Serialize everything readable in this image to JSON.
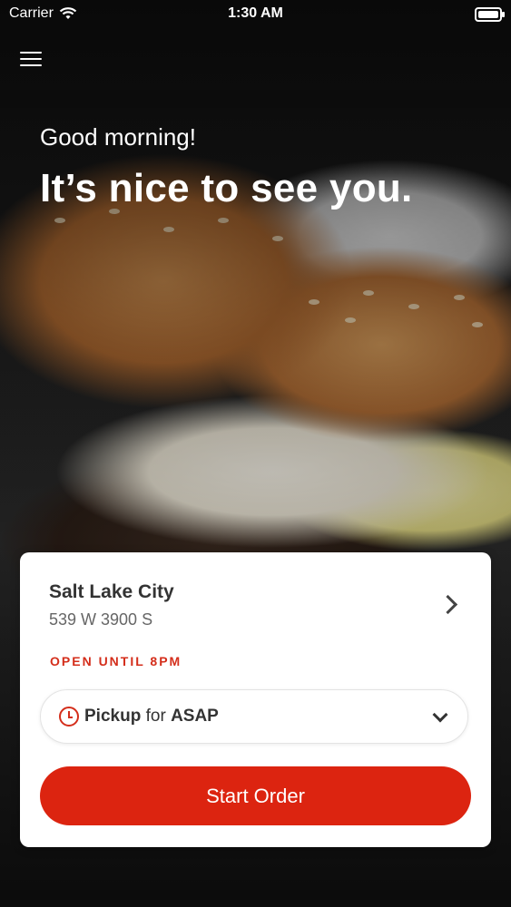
{
  "status_bar": {
    "carrier": "Carrier",
    "time": "1:30 AM"
  },
  "hero": {
    "greeting": "Good morning!",
    "headline": "It’s nice to see you."
  },
  "store": {
    "name": "Salt Lake City",
    "address": "539 W 3900 S",
    "hours": "OPEN UNTIL 8PM"
  },
  "order_mode": {
    "mode": "Pickup",
    "connector": "for",
    "time": "ASAP"
  },
  "actions": {
    "start_order": "Start Order"
  },
  "colors": {
    "accent": "#dc2410",
    "hours_text": "#d42e1b"
  },
  "icons": [
    "menu-icon",
    "wifi-icon",
    "battery-icon",
    "chevron-right-icon",
    "clock-icon",
    "chevron-down-icon"
  ]
}
